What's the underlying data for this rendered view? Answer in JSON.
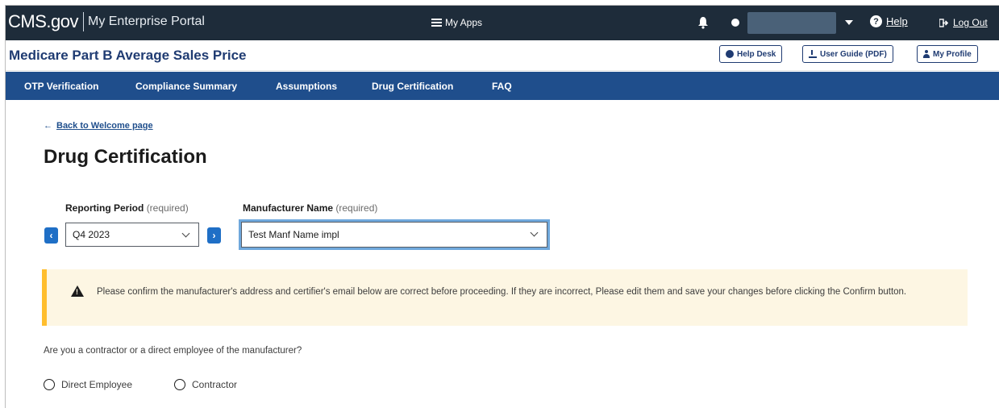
{
  "topbar": {
    "brand": "CMS.gov",
    "portal": "My Enterprise Portal",
    "my_apps": "My Apps",
    "help": "Help",
    "logout": "Log Out"
  },
  "titlebar": {
    "app_title": "Medicare Part B Average Sales Price",
    "help_desk": "Help Desk",
    "user_guide": "User Guide (PDF)",
    "my_profile": "My Profile"
  },
  "nav": {
    "items": [
      "OTP Verification",
      "Compliance Summary",
      "Assumptions",
      "Drug Certification",
      "FAQ"
    ]
  },
  "main": {
    "back_link": "Back to Welcome page",
    "page_title": "Drug Certification",
    "reporting_period": {
      "label": "Reporting Period",
      "required": "(required)",
      "value": "Q4 2023"
    },
    "manufacturer": {
      "label": "Manufacturer Name",
      "required": "(required)",
      "value": "Test Manf Name impl"
    },
    "alert_text": "Please confirm the manufacturer's address and certifier's email below are correct before proceeding. If they are incorrect, Please edit them and save your changes before clicking the Confirm button.",
    "question": "Are you a contractor or a direct employee of the manufacturer?",
    "options": [
      "Direct Employee",
      "Contractor"
    ]
  },
  "colors": {
    "topbar_bg": "#1e2c3a",
    "nav_bg": "#1f4e8c",
    "title_color": "#1f3b72",
    "alert_bg": "#fdf6e3",
    "alert_border": "#ffbe2e",
    "arrow_btn": "#1f6fc6"
  }
}
